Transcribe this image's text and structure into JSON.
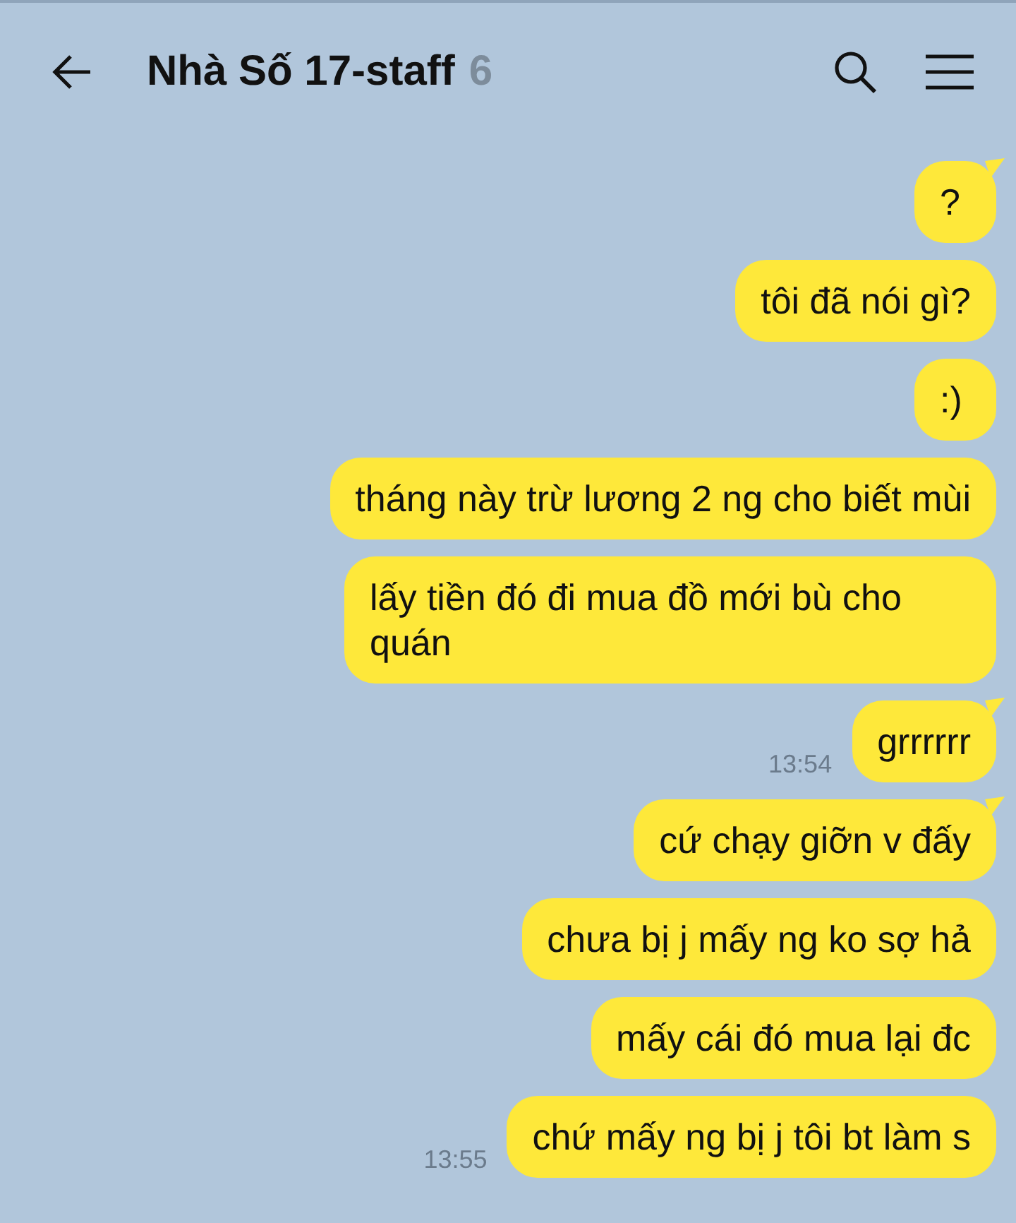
{
  "header": {
    "title": "Nhà Số 17-staff",
    "member_count": "6"
  },
  "messages": [
    {
      "text": "?",
      "tail": true
    },
    {
      "text": "tôi đã nói gì?",
      "tail": false
    },
    {
      "text": ":)",
      "tail": false
    },
    {
      "text": "tháng này trừ lương 2 ng cho biết mùi",
      "tail": false
    },
    {
      "text": "lấy tiền đó đi mua đồ mới bù cho quán",
      "tail": false
    },
    {
      "text": "grrrrrr",
      "tail": true,
      "time": "13:54"
    },
    {
      "text": "cứ chạy giỡn v đấy",
      "tail": true
    },
    {
      "text": "chưa bị j mấy ng ko sợ hả",
      "tail": false
    },
    {
      "text": "mấy cái đó mua lại đc",
      "tail": false
    },
    {
      "text": "chứ mấy ng bị j tôi bt làm s",
      "tail": false,
      "time": "13:55"
    }
  ]
}
